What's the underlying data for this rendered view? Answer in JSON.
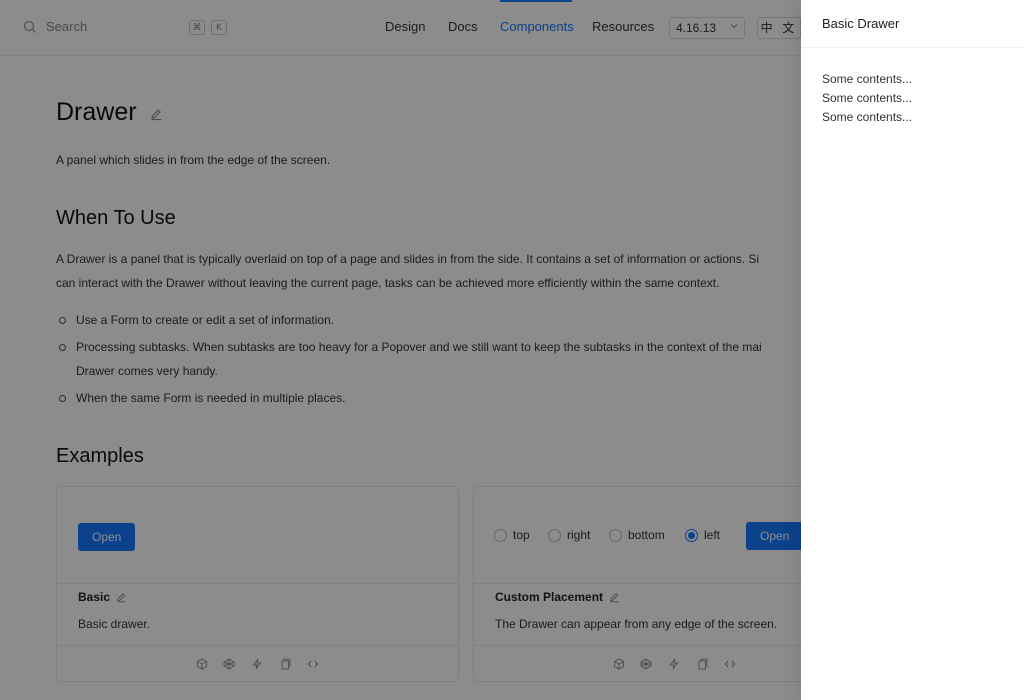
{
  "header": {
    "search_placeholder": "Search",
    "shortcut_keys": [
      "⌘",
      "K"
    ],
    "nav": [
      "Design",
      "Docs",
      "Components",
      "Resources"
    ],
    "active_nav": "Components",
    "version": "4.16.13",
    "lang_button": "中 文",
    "accent_color": "#1677ff"
  },
  "page": {
    "title": "Drawer",
    "subtitle": "A panel which slides in from the edge of the screen.",
    "when_heading": "When To Use",
    "when_para_line1": "A Drawer is a panel that is typically overlaid on top of a page and slides in from the side. It contains a set of information or actions. Si",
    "when_para_line2": "can interact with the Drawer without leaving the current page, tasks can be achieved more efficiently within the same context.",
    "bullets": [
      "Use a Form to create or edit a set of information.",
      "Processing subtasks. When subtasks are too heavy for a Popover and we still want to keep the subtasks in the context of the mai",
      "Drawer comes very handy.",
      "When the same Form is needed in multiple places."
    ],
    "examples_heading": "Examples"
  },
  "examples": [
    {
      "button": "Open",
      "title": "Basic",
      "description": "Basic drawer."
    },
    {
      "button": "Open",
      "title": "Custom Placement",
      "description": "The Drawer can appear from any edge of the screen.",
      "radio_options": [
        "top",
        "right",
        "bottom",
        "left"
      ],
      "selected": "left"
    }
  ],
  "card_action_icons": [
    "codesandbox-icon",
    "codepen-icon",
    "stackblitz-icon",
    "copy-icon",
    "code-icon"
  ],
  "drawer": {
    "title": "Basic Drawer",
    "contents": [
      "Some contents...",
      "Some contents...",
      "Some contents..."
    ]
  }
}
